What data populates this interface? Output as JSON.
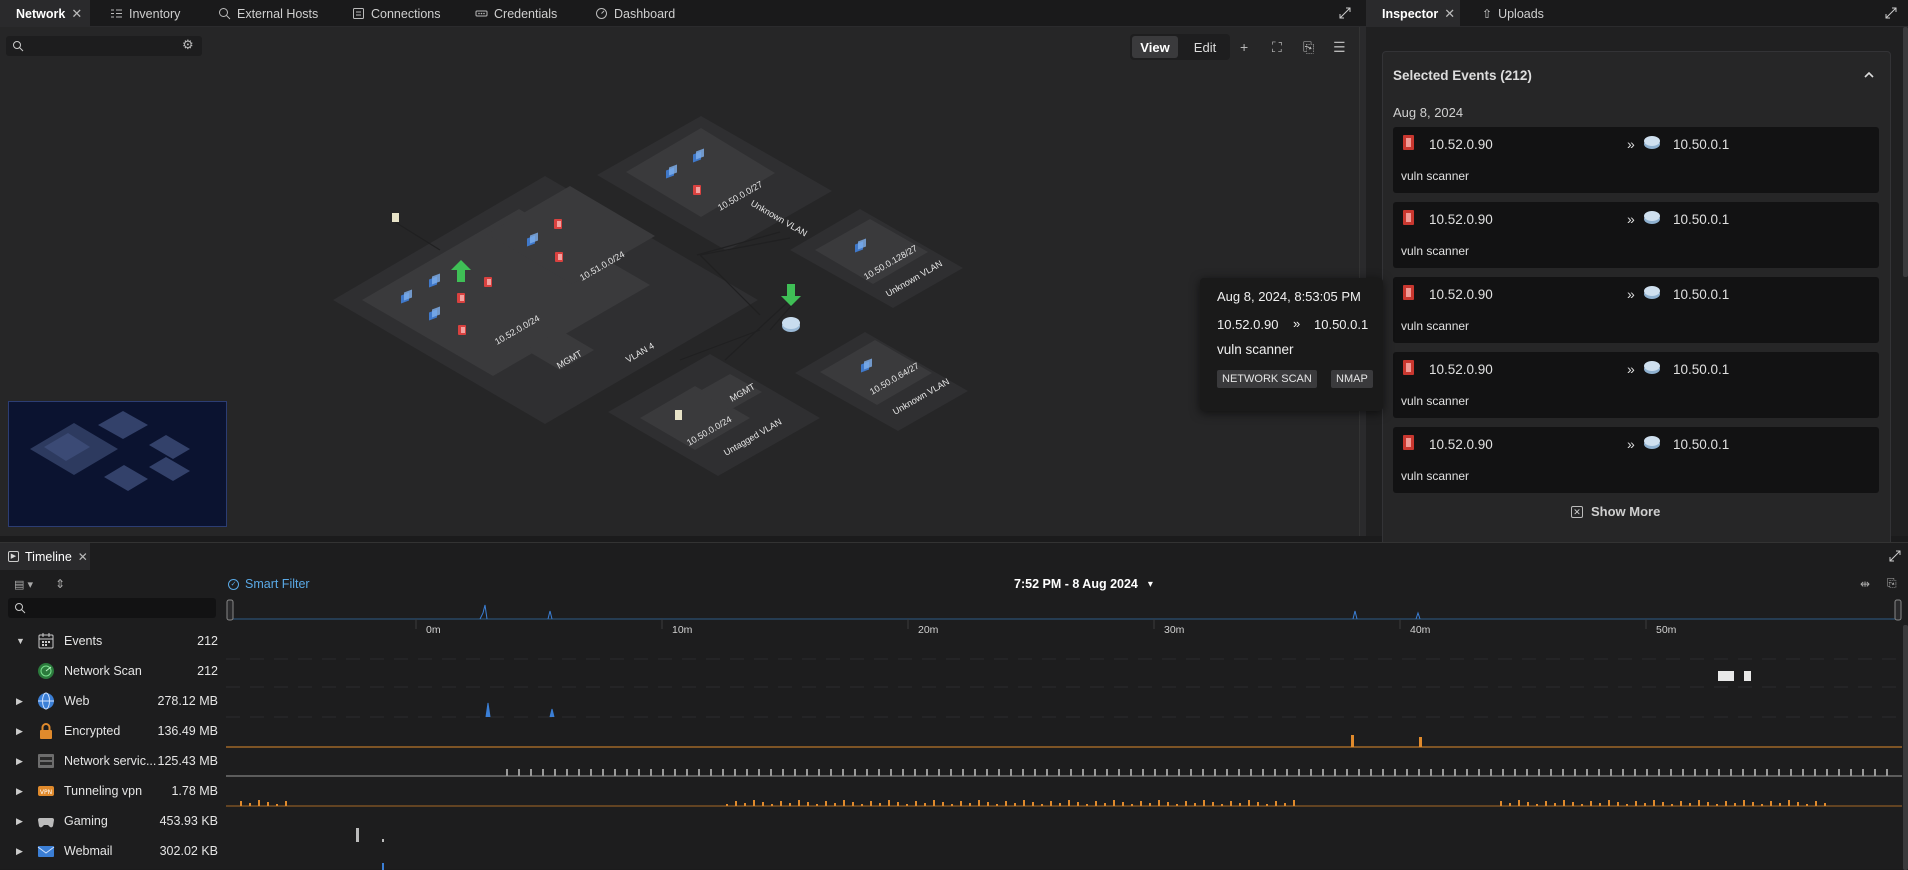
{
  "tabs": [
    {
      "label": "Network",
      "icon": "network-icon",
      "active": true
    },
    {
      "label": "Inventory",
      "icon": "inventory-icon"
    },
    {
      "label": "External Hosts",
      "icon": "external-hosts-icon"
    },
    {
      "label": "Connections",
      "icon": "connections-icon"
    },
    {
      "label": "Credentials",
      "icon": "credentials-icon"
    },
    {
      "label": "Dashboard",
      "icon": "dashboard-icon"
    }
  ],
  "right_tabs": [
    {
      "label": "Inspector",
      "active": true
    },
    {
      "label": "Uploads"
    }
  ],
  "network": {
    "view_label": "View",
    "edit_label": "Edit",
    "mode": "View",
    "subnets": [
      {
        "label": "10.52.0.0/24"
      },
      {
        "label": "10.51.0.0/24"
      },
      {
        "label": "10.50.0.0/27"
      },
      {
        "label": "Unknown VLAN"
      },
      {
        "label": "10.50.0.128/27"
      },
      {
        "label": "Unknown VLAN"
      },
      {
        "label": "10.50.0.64/27"
      },
      {
        "label": "Unknown VLAN"
      },
      {
        "label": "10.50.0.0/24"
      },
      {
        "label": "Untagged VLAN"
      },
      {
        "label": "VLAN 4"
      },
      {
        "label": "MGMT"
      },
      {
        "label": "MGMT"
      }
    ]
  },
  "inspector": {
    "title": "Selected Events (212)",
    "date": "Aug 8, 2024",
    "events": [
      {
        "src": "10.52.0.90",
        "dst": "10.50.0.1",
        "label": "vuln scanner"
      },
      {
        "src": "10.52.0.90",
        "dst": "10.50.0.1",
        "label": "vuln scanner"
      },
      {
        "src": "10.52.0.90",
        "dst": "10.50.0.1",
        "label": "vuln scanner"
      },
      {
        "src": "10.52.0.90",
        "dst": "10.50.0.1",
        "label": "vuln scanner"
      },
      {
        "src": "10.52.0.90",
        "dst": "10.50.0.1",
        "label": "vuln scanner"
      }
    ],
    "show_more": "Show More",
    "arrow": "»"
  },
  "tooltip": {
    "datetime": "Aug 8, 2024, 8:53:05 PM",
    "src": "10.52.0.90",
    "arrow": "»",
    "dst": "10.50.0.1",
    "label": "vuln scanner",
    "tags": [
      "NETWORK SCAN",
      "NMAP"
    ]
  },
  "timeline": {
    "tab_label": "Timeline",
    "smart_filter": "Smart Filter",
    "time_range": "7:52 PM - 8 Aug 2024",
    "ticks": [
      "0m",
      "10m",
      "20m",
      "30m",
      "40m",
      "50m"
    ],
    "rows": [
      {
        "name": "Events",
        "value": "212",
        "expanded": true,
        "icon": "calendar-icon",
        "color": "#cccccc"
      },
      {
        "name": "Network Scan",
        "value": "212",
        "child": true,
        "icon": "radar-icon",
        "color": "#3aa655"
      },
      {
        "name": "Web",
        "value": "278.12 MB",
        "icon": "globe-icon",
        "color": "#3b7fd6"
      },
      {
        "name": "Encrypted",
        "value": "136.49 MB",
        "icon": "lock-icon",
        "color": "#e08a2c"
      },
      {
        "name": "Network servic...",
        "value": "125.43 MB",
        "icon": "server-icon",
        "color": "#9a9a9a"
      },
      {
        "name": "Tunneling vpn",
        "value": "1.78 MB",
        "icon": "vpn-icon",
        "color": "#e08a2c"
      },
      {
        "name": "Gaming",
        "value": "453.93 KB",
        "icon": "gamepad-icon",
        "color": "#bbbbbb"
      },
      {
        "name": "Webmail",
        "value": "302.02 KB",
        "icon": "mail-icon",
        "color": "#3b7fd6"
      }
    ]
  },
  "colors": {
    "accent": "#5aa9e6",
    "web": "#3b7fd6",
    "encrypted": "#e08a2c",
    "service": "#9a9a9a",
    "arrow_green": "#3fbf56",
    "red_host": "#d9413f"
  }
}
